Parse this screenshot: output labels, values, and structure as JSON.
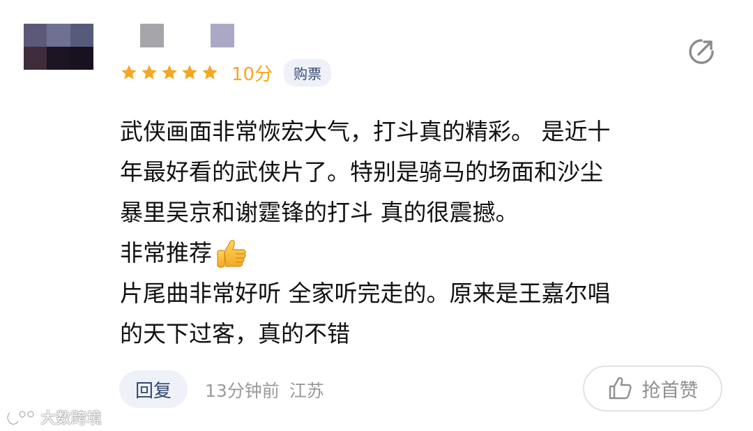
{
  "avatar": {
    "mosaic_colors": [
      "#5b5878",
      "#6e7192",
      "#565b7c",
      "#3e2c3a",
      "#1c1422",
      "#181220"
    ]
  },
  "share_icon": "share-icon",
  "rating": {
    "stars": 5,
    "star_color": "#f5a623",
    "score": "10分",
    "badge": "购票"
  },
  "comment": {
    "lines": [
      "武侠画面非常恢宏大气，打斗真的精彩。 是近十",
      "年最好看的武侠片了。特别是骑马的场面和沙尘",
      "暴里吴京和谢霆锋的打斗  真的很震撼。",
      "非常推荐",
      "片尾曲非常好听  全家听完走的。原来是王嘉尔唱",
      "的天下过客，真的不错"
    ],
    "emoji": "thumbs-up-emoji"
  },
  "footer": {
    "reply": "回复",
    "time": "13分钟前",
    "location": "江苏",
    "like": "抢首赞"
  },
  "watermark": {
    "text": "大数跨境"
  }
}
